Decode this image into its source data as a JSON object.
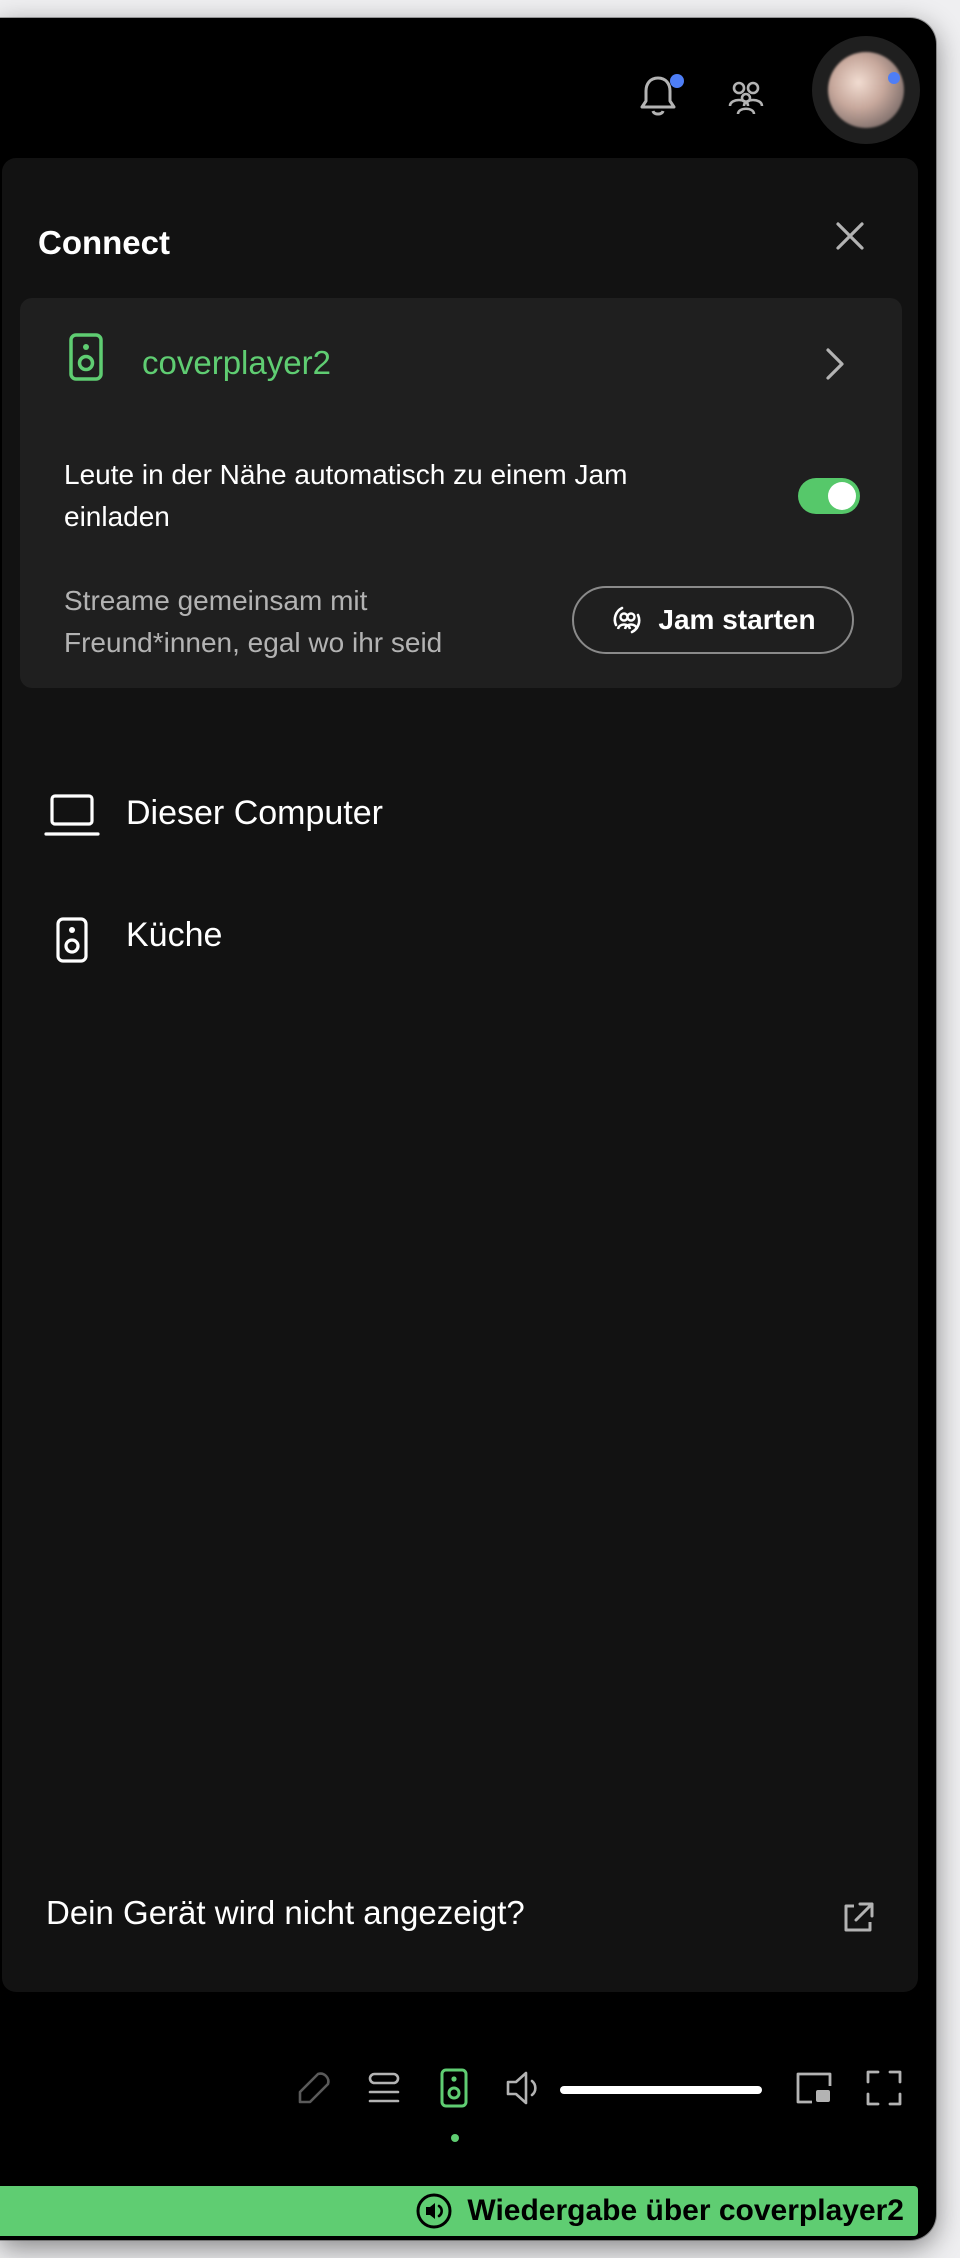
{
  "panel": {
    "title": "Connect",
    "active_device": {
      "name": "coverplayer2",
      "auto_invite_label": "Leute in der Nähe automatisch zu einem Jam einladen",
      "auto_invite_enabled": true,
      "jam_description": "Streame gemeinsam mit Freund*innen, egal wo ihr seid",
      "jam_button_label": "Jam starten"
    },
    "devices": [
      {
        "name": "Dieser Computer",
        "icon": "laptop-icon"
      },
      {
        "name": "Küche",
        "icon": "speaker-icon"
      }
    ],
    "help_link": "Dein Gerät wird nicht angezeigt?"
  },
  "topbar": {
    "notifications_unread": true,
    "icons": [
      "bell-icon",
      "friends-icon",
      "avatar"
    ]
  },
  "player_controls": {
    "icons": [
      "lyrics-mic-icon",
      "queue-icon",
      "connect-device-icon",
      "volume-icon",
      "mini-player-icon",
      "fullscreen-icon"
    ],
    "volume_level": 1.0
  },
  "banner": {
    "text": "Wiedergabe über coverplayer2"
  },
  "colors": {
    "accent": "#5fcd72",
    "background": "#000000",
    "panel": "#121212",
    "card": "#1f1f1f",
    "notification_dot": "#4e7ef6"
  }
}
